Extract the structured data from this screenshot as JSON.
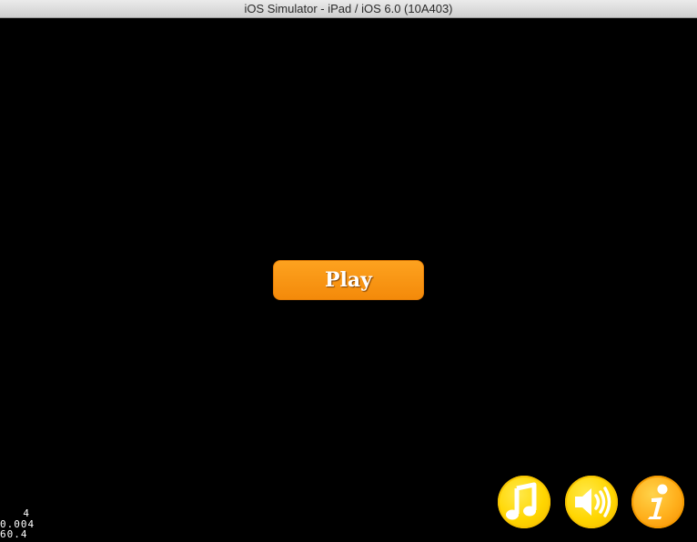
{
  "window": {
    "title": "iOS Simulator - iPad / iOS 6.0 (10A403)"
  },
  "menu": {
    "play_label": "Play"
  },
  "controls": [
    {
      "name": "music",
      "icon": "music-note-icon"
    },
    {
      "name": "sound",
      "icon": "speaker-icon"
    },
    {
      "name": "info",
      "icon": "info-icon"
    }
  ],
  "debug_stats": {
    "draw_calls": "4",
    "frame_time": "0.004",
    "fps": "60.4"
  },
  "colors": {
    "play_button": "#f7930f",
    "round_button": "#ffd600",
    "info_button": "#ffa812",
    "background": "#000000"
  }
}
